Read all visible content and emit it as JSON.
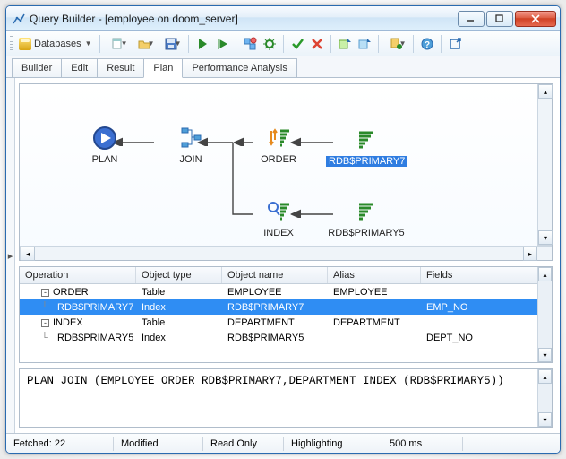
{
  "window": {
    "title": "Query Builder - [employee on doom_server]"
  },
  "toolbar": {
    "databases_label": "Databases"
  },
  "tabs": [
    "Builder",
    "Edit",
    "Result",
    "Plan",
    "Performance Analysis"
  ],
  "tabs_active_index": 3,
  "diagram": {
    "nodes": {
      "plan": "PLAN",
      "join": "JOIN",
      "order": "ORDER",
      "rp7": "RDB$PRIMARY7",
      "index": "INDEX",
      "rp5": "RDB$PRIMARY5"
    },
    "selected": "rp7"
  },
  "grid": {
    "headers": [
      "Operation",
      "Object type",
      "Object name",
      "Alias",
      "Fields"
    ],
    "rows": [
      {
        "indent": 0,
        "expand": "-",
        "op": "ORDER",
        "type": "Table",
        "name": "EMPLOYEE",
        "alias": "EMPLOYEE",
        "fields": "",
        "sel": false
      },
      {
        "indent": 1,
        "expand": "",
        "op": "RDB$PRIMARY7",
        "type": "Index",
        "name": "RDB$PRIMARY7",
        "alias": "",
        "fields": "EMP_NO",
        "sel": true
      },
      {
        "indent": 0,
        "expand": "-",
        "op": "INDEX",
        "type": "Table",
        "name": "DEPARTMENT",
        "alias": "DEPARTMENT",
        "fields": "",
        "sel": false
      },
      {
        "indent": 1,
        "expand": "",
        "op": "RDB$PRIMARY5",
        "type": "Index",
        "name": "RDB$PRIMARY5",
        "alias": "",
        "fields": "DEPT_NO",
        "sel": false
      }
    ]
  },
  "sql_text": "PLAN JOIN (EMPLOYEE ORDER RDB$PRIMARY7,DEPARTMENT INDEX (RDB$PRIMARY5))",
  "status": {
    "fetched_label": "Fetched:",
    "fetched_value": "22",
    "modified": "Modified",
    "readonly": "Read Only",
    "highlighting": "Highlighting",
    "time": "500 ms"
  }
}
